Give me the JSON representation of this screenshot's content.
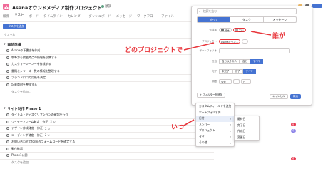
{
  "header": {
    "title": "Asanaオウンドメディア制作プロジェクト",
    "status": "順調",
    "tabs": [
      "概要",
      "リスト",
      "ボード",
      "タイムライン",
      "カレンダー",
      "ダッシュボード",
      "メッセージ",
      "ワークフロー",
      "ファイル"
    ],
    "active_tab": "リスト"
  },
  "toolbar": {
    "add_task": "+ タスクを追加"
  },
  "columns": {
    "task_name": "タスク名"
  },
  "sections": [
    {
      "name": "事前準備",
      "tasks": [
        "Asanaの下書きを作成",
        "執筆から掲載時点の情報を収集する",
        "カスタマーシーンーを作成する",
        "書籍とシリーズ一覧の情報を整理する",
        "ブランドロゴの用紙を決定",
        "記載商材を整理する"
      ],
      "add": "タスクを追加..."
    },
    {
      "name": "サイト制作 Phase 1",
      "tasks": [
        "タイトル・ディスクリプションの確認を行う",
        "ワイヤーフレーム確定・修正",
        "デザイン作成確定・修正",
        "コーディング確定・修正",
        "お問い合わせのformのフォームコードを確定する",
        "動作確認",
        "Phase1公開"
      ],
      "counts": [
        "",
        "2 ↻",
        "2 ↻",
        "2 ↻",
        "",
        "",
        ""
      ],
      "add": "タスクを追加..."
    }
  ],
  "filter_panel": {
    "search_placeholder": "検索を始む",
    "segments": [
      "すべて",
      "タスク",
      "メッセージ"
    ],
    "active_segment": "すべて",
    "author_label": "作成者",
    "authors": [
      "鈴木",
      "工川"
    ],
    "project_label": "プロジェクト",
    "project_value": "Asanaオウン...",
    "project_add": "+",
    "portfolio_label": "ポートフォリオ",
    "assignee_label": "担当",
    "assignee_options": [
      "自分以外の人",
      "自分",
      "すべて"
    ],
    "done_label": "完了",
    "done_options": [
      "未完了",
      "完了",
      "すべて"
    ],
    "date_label": "期限",
    "date_value": "今後",
    "date_amount": "日",
    "add_filter": "+ フィルターを追加",
    "cancel": "キャンセル",
    "search": "検索"
  },
  "filter_menu": {
    "items": [
      "カスタムフィールドを追加",
      "ポートフォリオ内",
      "日付",
      "メンバー",
      "プロジェクト",
      "タグ",
      "その他"
    ],
    "highlighted": "日付"
  },
  "date_submenu": {
    "items": [
      "最終日",
      "完了日",
      "作成日",
      "変更日"
    ]
  },
  "annotations": {
    "where": "どのプロジェクトで",
    "who": "誰が",
    "when": "いつ"
  },
  "tags": [
    {
      "label": "高",
      "color": "#e8384f"
    },
    {
      "label": "中",
      "color": "#8d84e8"
    },
    {
      "label": "高",
      "color": "#e8384f"
    }
  ]
}
